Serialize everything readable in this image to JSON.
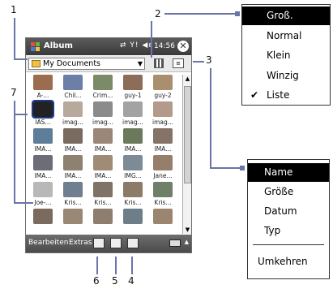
{
  "titlebar": {
    "title": "Album",
    "clock": "14:56",
    "signal_icons": "⇄ Y! ◀ε"
  },
  "folder": {
    "selected": "My Documents"
  },
  "grid": [
    {
      "caption": "A-...",
      "color": "#9b6c4e"
    },
    {
      "caption": "Chil...",
      "color": "#6d7fa6"
    },
    {
      "caption": "Crim...",
      "color": "#7c8a69"
    },
    {
      "caption": "guy-1",
      "color": "#8c6d5a"
    },
    {
      "caption": "guy-2",
      "color": "#a98f6e"
    },
    {
      "caption": "IAS...",
      "color": "#222222"
    },
    {
      "caption": "imag...",
      "color": "#b7a99b"
    },
    {
      "caption": "imag...",
      "color": "#8b8b8b"
    },
    {
      "caption": "imag...",
      "color": "#a3a3a3"
    },
    {
      "caption": "imag...",
      "color": "#b39a8a"
    },
    {
      "caption": "IMA...",
      "color": "#5e7d98"
    },
    {
      "caption": "IMA...",
      "color": "#7a6b60"
    },
    {
      "caption": "IMA...",
      "color": "#9a8779"
    },
    {
      "caption": "IMA...",
      "color": "#6b7a5c"
    },
    {
      "caption": "IMA...",
      "color": "#847366"
    },
    {
      "caption": "IMA...",
      "color": "#6d6d78"
    },
    {
      "caption": "IMA...",
      "color": "#8d8270"
    },
    {
      "caption": "IMA...",
      "color": "#a08b77"
    },
    {
      "caption": "IMG...",
      "color": "#7d8b97"
    },
    {
      "caption": "Jane...",
      "color": "#957f6b"
    },
    {
      "caption": "Joe-...",
      "color": "#b8b8b8"
    },
    {
      "caption": "Kris...",
      "color": "#6f7f90"
    },
    {
      "caption": "Kris...",
      "color": "#7f7266"
    },
    {
      "caption": "Kris...",
      "color": "#8c7b68"
    },
    {
      "caption": "Kris...",
      "color": "#6e8068"
    },
    {
      "caption": "",
      "color": "#7b6a5e"
    },
    {
      "caption": "",
      "color": "#9a8876"
    },
    {
      "caption": "",
      "color": "#8d7e70"
    },
    {
      "caption": "",
      "color": "#6e7e88"
    },
    {
      "caption": "",
      "color": "#9c8570"
    }
  ],
  "bottombar": {
    "menu_left": "Bearbeiten",
    "menu_right": "Extras"
  },
  "size_menu": {
    "items": [
      "Groß.",
      "Normal",
      "Klein",
      "Winzig",
      "Liste"
    ],
    "highlighted": "Groß.",
    "checked": "Liste",
    "check_glyph": "✔"
  },
  "sort_menu": {
    "items": [
      "Name",
      "Größe",
      "Datum",
      "Typ"
    ],
    "highlighted": "Name",
    "reverse": "Umkehren"
  },
  "callouts": [
    "1",
    "2",
    "3",
    "4",
    "5",
    "6",
    "7"
  ],
  "colors": {
    "callout_line": "#6b74a8",
    "highlight": "#000000"
  }
}
